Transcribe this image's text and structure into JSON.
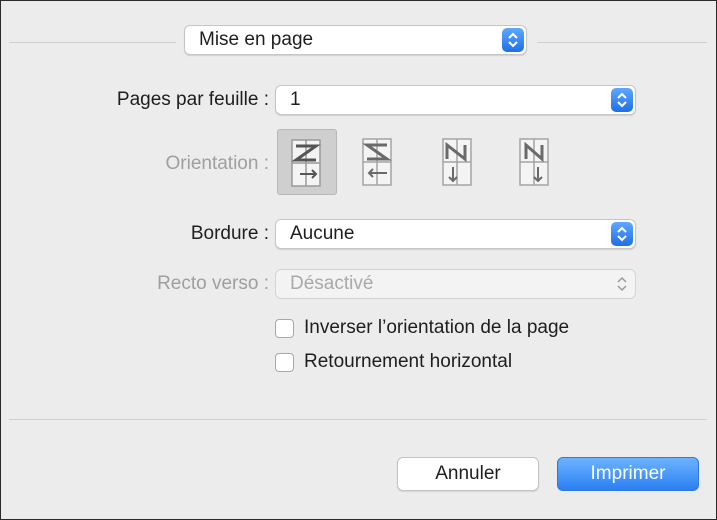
{
  "section_popup": {
    "value": "Mise en page"
  },
  "pages_per_sheet": {
    "label": "Pages par feuille :",
    "value": "1"
  },
  "orientation": {
    "label": "Orientation :",
    "options": [
      "z-layout-icon",
      "reverse-z-layout-icon",
      "n-reverse-layout-icon",
      "n-layout-icon"
    ],
    "selected_index": 0
  },
  "border": {
    "label": "Bordure :",
    "value": "Aucune"
  },
  "two_sided": {
    "label": "Recto verso :",
    "value": "Désactivé"
  },
  "checkboxes": {
    "reverse_orientation": {
      "label": "Inverser l’orientation de la page",
      "checked": false
    },
    "flip_horizontal": {
      "label": "Retournement horizontal",
      "checked": false
    }
  },
  "buttons": {
    "cancel": "Annuler",
    "print": "Imprimer"
  },
  "colors": {
    "accent": "#2b7ff2",
    "background": "#ececec"
  }
}
